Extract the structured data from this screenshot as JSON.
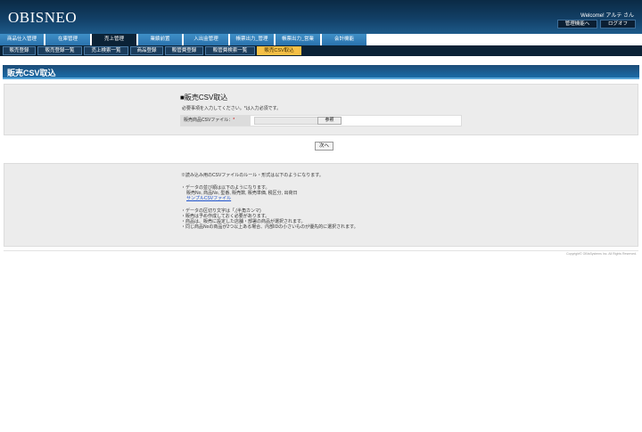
{
  "header": {
    "logo": "OBISNEO",
    "welcome": "Welcome! アルテ さん",
    "admin_button": "管理機能へ",
    "logout_button": "ログオフ"
  },
  "main_tabs": [
    {
      "label": "商品仕入管理"
    },
    {
      "label": "在庫管理"
    },
    {
      "label": "売上管理",
      "active": true
    },
    {
      "label": "業績前置"
    },
    {
      "label": "入出金管理"
    },
    {
      "label": "帳票出力_管理"
    },
    {
      "label": "帳票出力_営業"
    },
    {
      "label": "会計機能"
    }
  ],
  "sub_tabs": [
    {
      "label": "販売登録"
    },
    {
      "label": "販売登録一覧"
    },
    {
      "label": "売上検索一覧"
    },
    {
      "label": "商品登録"
    },
    {
      "label": "販管費登録"
    },
    {
      "label": "販管費検索一覧"
    },
    {
      "label": "販売CSV取込",
      "active": true
    }
  ],
  "page_title": "販売CSV取込",
  "form": {
    "section_title": "■販売CSV取込",
    "note": "必要事項を入力してください。*は入力必須です。",
    "file_label": "販売商品CSVファイル：",
    "required_mark": "*",
    "browse_button": "参照",
    "next_button": "次へ"
  },
  "rules": {
    "intro": "※読み込み用のCSVファイルのルール・形式は以下のようになります。",
    "order_heading": "・データの並び順は以下のようになります。",
    "order_fields": "販売No, 商品No, 型番, 販売数, 販売単価, 税区分, 出荷日",
    "sample_link": "サンプルCSVファイル",
    "delimiter": "・データの区切り文字は「,(半角カンマ)",
    "note1": "・販売は予め作成しておく必要があります。",
    "note2": "・商品は、販売に設定した店舗・部署の商品が選択されます。",
    "note3": "・同じ商品Noの商品が2つ以上ある場合、内部IDの小さいものが優先的に選択されます。"
  },
  "footer": {
    "copyright": "Copyright© OBIsSystems Inc. All Rights Reserved."
  }
}
